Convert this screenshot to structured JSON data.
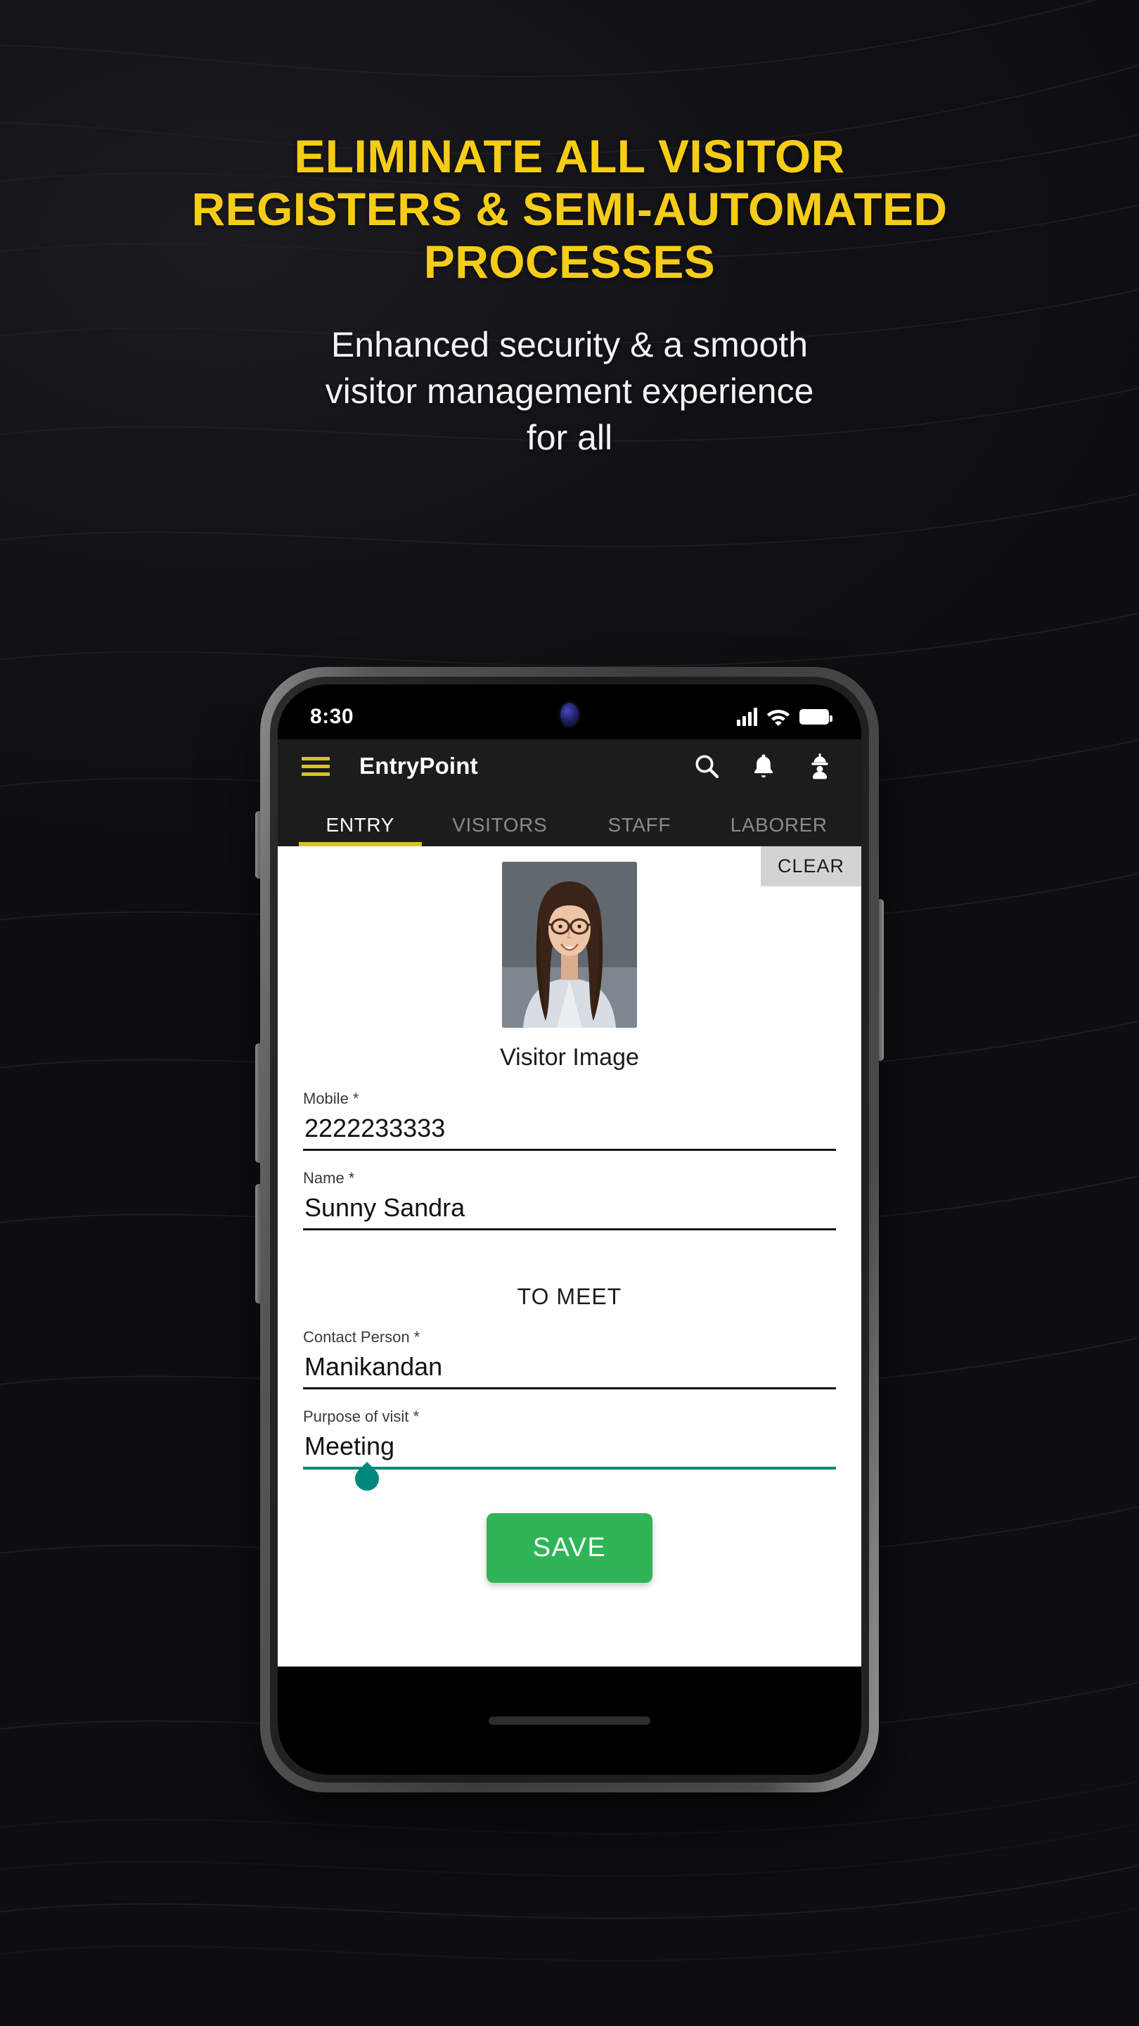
{
  "hero": {
    "headline_lines": [
      "ELIMINATE ALL VISITOR",
      "REGISTERS & SEMI-AUTOMATED",
      "PROCESSES"
    ],
    "subhead_lines": [
      "Enhanced security & a smooth",
      "visitor management experience",
      "for all"
    ],
    "headline_color": "#f5cc18",
    "subhead_color": "#f3f3f3"
  },
  "phone": {
    "status_bar": {
      "time": "8:30",
      "icons": [
        "signal-bars-icon",
        "wifi-icon",
        "battery-icon"
      ]
    },
    "app_bar": {
      "menu_icon": "hamburger-menu-icon",
      "title": "EntryPoint",
      "accent_color": "#d9c41f",
      "icons": [
        "search-icon",
        "notification-bell-icon",
        "worker-helmet-icon"
      ]
    },
    "tabs": [
      {
        "label": "ENTRY",
        "active": true
      },
      {
        "label": "VISITORS",
        "active": false
      },
      {
        "label": "STAFF",
        "active": false
      },
      {
        "label": "LABORER",
        "active": false
      }
    ],
    "form": {
      "clear_label": "CLEAR",
      "photo_caption": "Visitor Image",
      "fields": [
        {
          "label": "Mobile *",
          "value": "2222233333",
          "focused": false
        },
        {
          "label": "Name *",
          "value": "Sunny Sandra",
          "focused": false
        }
      ],
      "section_title": "TO MEET",
      "meet_fields": [
        {
          "label": "Contact Person *",
          "value": "Manikandan",
          "focused": false
        },
        {
          "label": "Purpose of visit *",
          "value": "Meeting",
          "focused": true
        }
      ],
      "save_label": "SAVE",
      "save_color": "#2fb457",
      "focus_color": "#00897b"
    },
    "nav": {
      "home_indicator": true
    }
  }
}
